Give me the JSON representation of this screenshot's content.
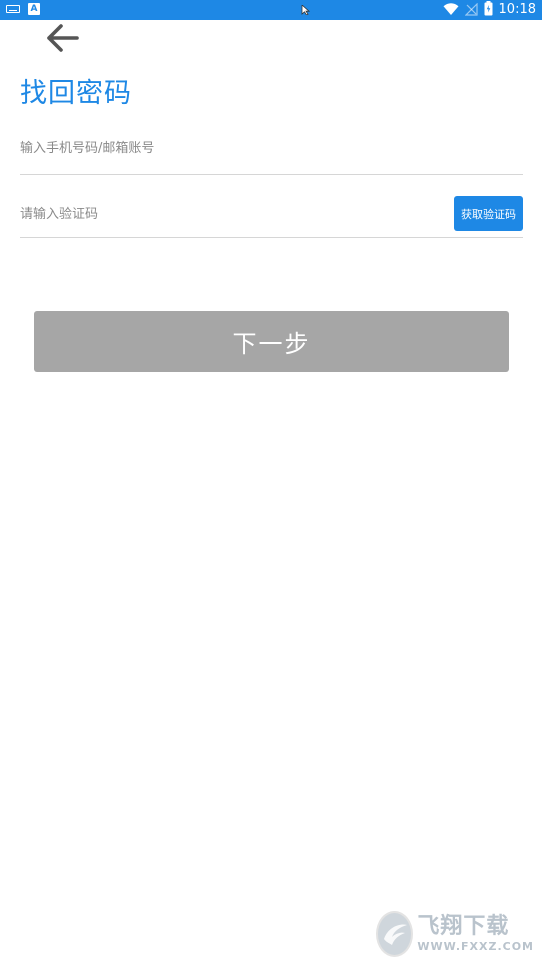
{
  "status_bar": {
    "time": "10:18",
    "a_icon_label": "A",
    "colors": {
      "background": "#1e88e5",
      "foreground": "#ffffff"
    },
    "icons": [
      "keyboard-icon",
      "accessibility-a-icon",
      "wifi-icon",
      "signal-icon",
      "battery-icon"
    ]
  },
  "header": {
    "back_icon": "arrow-left-icon",
    "title": "找回密码"
  },
  "form": {
    "account_placeholder": "输入手机号码/邮箱账号",
    "account_value": "",
    "code_placeholder": "请输入验证码",
    "code_value": "",
    "get_code_label": "获取验证码"
  },
  "actions": {
    "next_label": "下一步"
  },
  "watermark": {
    "title": "飞翔下载",
    "url": "WWW.FXXZ.COM"
  },
  "colors": {
    "accent": "#1e88e5",
    "disabled_button": "#a6a6a6",
    "divider": "#d6d6d6",
    "placeholder": "#8a8a8a"
  }
}
